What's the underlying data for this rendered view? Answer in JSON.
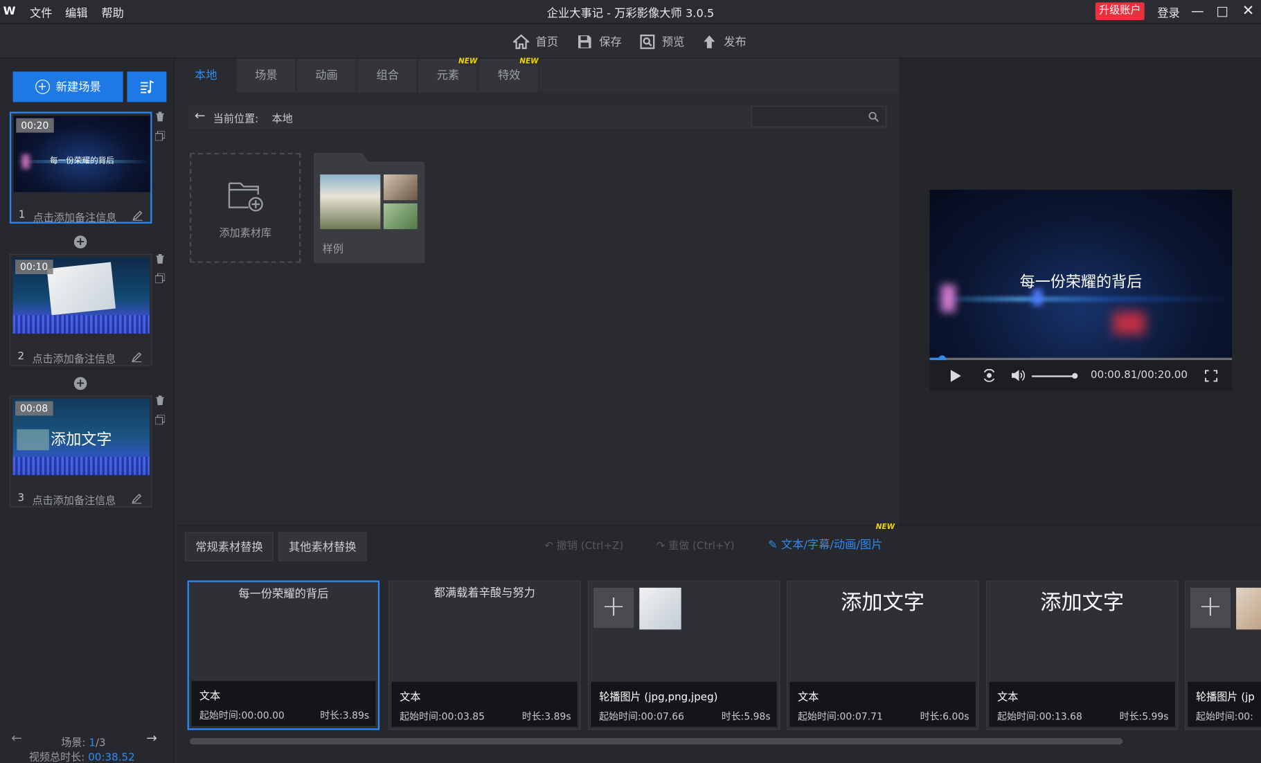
{
  "app": {
    "logo": "W",
    "menu": [
      "文件",
      "编辑",
      "帮助"
    ],
    "title": "企业大事记 - 万彩影像大师 3.0.5",
    "upgrade_label": "升级账户",
    "login_label": "登录"
  },
  "toolbar": {
    "home": "首页",
    "save": "保存",
    "preview": "预览",
    "publish": "发布"
  },
  "sidebar": {
    "new_scene_label": "新建场景",
    "scenes": [
      {
        "index": "1",
        "duration": "00:20",
        "note": "点击添加备注信息",
        "thumb_text": "每一份荣耀的背后"
      },
      {
        "index": "2",
        "duration": "00:10",
        "note": "点击添加备注信息",
        "thumb_text": ""
      },
      {
        "index": "3",
        "duration": "00:08",
        "note": "点击添加备注信息",
        "thumb_text": "添加文字"
      }
    ],
    "footer": {
      "scene_label": "场景: ",
      "scene_current": "1",
      "scene_total": "/3",
      "total_label": "视频总时长: ",
      "total_value": "00:38.52"
    }
  },
  "library": {
    "tabs": [
      {
        "label": "本地",
        "new": false
      },
      {
        "label": "场景",
        "new": false
      },
      {
        "label": "动画",
        "new": false
      },
      {
        "label": "组合",
        "new": false
      },
      {
        "label": "元素",
        "new": true
      },
      {
        "label": "特效",
        "new": true
      }
    ],
    "new_badge": "NEW",
    "location_label": "当前位置:",
    "location_value": "本地",
    "search_placeholder": "",
    "add_library_label": "添加素材库",
    "sample_folder_label": "样例"
  },
  "preview": {
    "video_text": "每一份荣耀的背后",
    "time": "00:00.81/00:20.00",
    "progress": 0.04,
    "volume": 0.95
  },
  "bottom": {
    "tabs": [
      "常规素材替换",
      "其他素材替换"
    ],
    "undo_label": "撤销 (Ctrl+Z)",
    "redo_label": "重做 (Ctrl+Y)",
    "edit_label": "文本/字幕/动画/图片",
    "new_badge": "NEW",
    "cards": [
      {
        "kind": "text",
        "content": "每一份荣耀的背后",
        "type": "文本",
        "start": "起始时间:00:00.00",
        "length": "时长:3.89s"
      },
      {
        "kind": "text",
        "content": "都满载着辛酸与努力",
        "type": "文本",
        "start": "起始时间:00:03.85",
        "length": "时长:3.89s"
      },
      {
        "kind": "image",
        "content": "",
        "type": "轮播图片 (jpg,png,jpeg)",
        "start": "起始时间:00:07.66",
        "length": "时长:5.98s"
      },
      {
        "kind": "bigtext",
        "content": "添加文字",
        "type": "文本",
        "start": "起始时间:00:07.71",
        "length": "时长:6.00s"
      },
      {
        "kind": "bigtext",
        "content": "添加文字",
        "type": "文本",
        "start": "起始时间:00:13.68",
        "length": "时长:5.99s"
      },
      {
        "kind": "image",
        "content": "",
        "type": "轮播图片 (jp",
        "start": "起始时间:00:",
        "length": ""
      }
    ]
  },
  "colors": {
    "accent": "#1e78e6",
    "upgrade": "#e8313f",
    "new_badge": "#f2d300"
  }
}
